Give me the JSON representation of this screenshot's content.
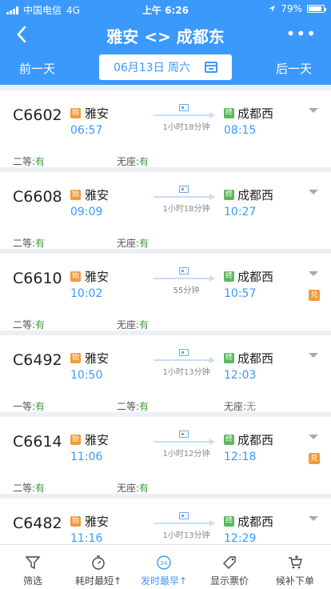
{
  "status": {
    "carrier": "中国电信",
    "network": "4G",
    "time": "上午 6:26",
    "battery": "79%"
  },
  "nav": {
    "title": "雅安 <> 成都东",
    "more": "•••"
  },
  "datebar": {
    "prev": "前一天",
    "date": "06月13日 周六",
    "next": "后一天"
  },
  "markers": {
    "start": "始",
    "end": "终",
    "exchange": "兑"
  },
  "trains": [
    {
      "no": "C6602",
      "from": "雅安",
      "depart": "06:57",
      "duration": "1小时18分钟",
      "to": "成都西",
      "arrive": "08:15",
      "exchange": false,
      "seats": [
        {
          "label": "二等:",
          "value": "有",
          "avail": true
        },
        {
          "label": "无座:",
          "value": "有",
          "avail": true
        }
      ]
    },
    {
      "no": "C6608",
      "from": "雅安",
      "depart": "09:09",
      "duration": "1小时18分钟",
      "to": "成都西",
      "arrive": "10:27",
      "exchange": false,
      "seats": [
        {
          "label": "二等:",
          "value": "有",
          "avail": true
        },
        {
          "label": "无座:",
          "value": "有",
          "avail": true
        }
      ]
    },
    {
      "no": "C6610",
      "from": "雅安",
      "depart": "10:02",
      "duration": "55分钟",
      "to": "成都西",
      "arrive": "10:57",
      "exchange": true,
      "seats": [
        {
          "label": "二等:",
          "value": "有",
          "avail": true
        },
        {
          "label": "无座:",
          "value": "有",
          "avail": true
        }
      ]
    },
    {
      "no": "C6492",
      "from": "雅安",
      "depart": "10:50",
      "duration": "1小时13分钟",
      "to": "成都西",
      "arrive": "12:03",
      "exchange": false,
      "seats": [
        {
          "label": "一等:",
          "value": "有",
          "avail": true
        },
        {
          "label": "二等:",
          "value": "有",
          "avail": true
        },
        {
          "label": "无座:",
          "value": "无",
          "avail": false
        }
      ]
    },
    {
      "no": "C6614",
      "from": "雅安",
      "depart": "11:06",
      "duration": "1小时12分钟",
      "to": "成都西",
      "arrive": "12:18",
      "exchange": true,
      "seats": [
        {
          "label": "二等:",
          "value": "有",
          "avail": true
        },
        {
          "label": "无座:",
          "value": "有",
          "avail": true
        }
      ]
    },
    {
      "no": "C6482",
      "from": "雅安",
      "depart": "11:16",
      "duration": "1小时13分钟",
      "to": "成都西",
      "arrive": "12:29",
      "exchange": false,
      "seats": []
    }
  ],
  "tabs": [
    {
      "label": "筛选",
      "icon": "filter-icon",
      "active": false
    },
    {
      "label": "耗时最短↑",
      "icon": "timer-icon",
      "active": false
    },
    {
      "label": "发时最早↑",
      "icon": "clock-24-icon",
      "active": true
    },
    {
      "label": "显示票价",
      "icon": "price-tag-icon",
      "active": false
    },
    {
      "label": "候补下单",
      "icon": "cart-plus-icon",
      "active": false
    }
  ],
  "colors": {
    "primary": "#3b99fc",
    "available": "#3a9b3a",
    "start": "#f39a3c",
    "end": "#5cb85c"
  }
}
